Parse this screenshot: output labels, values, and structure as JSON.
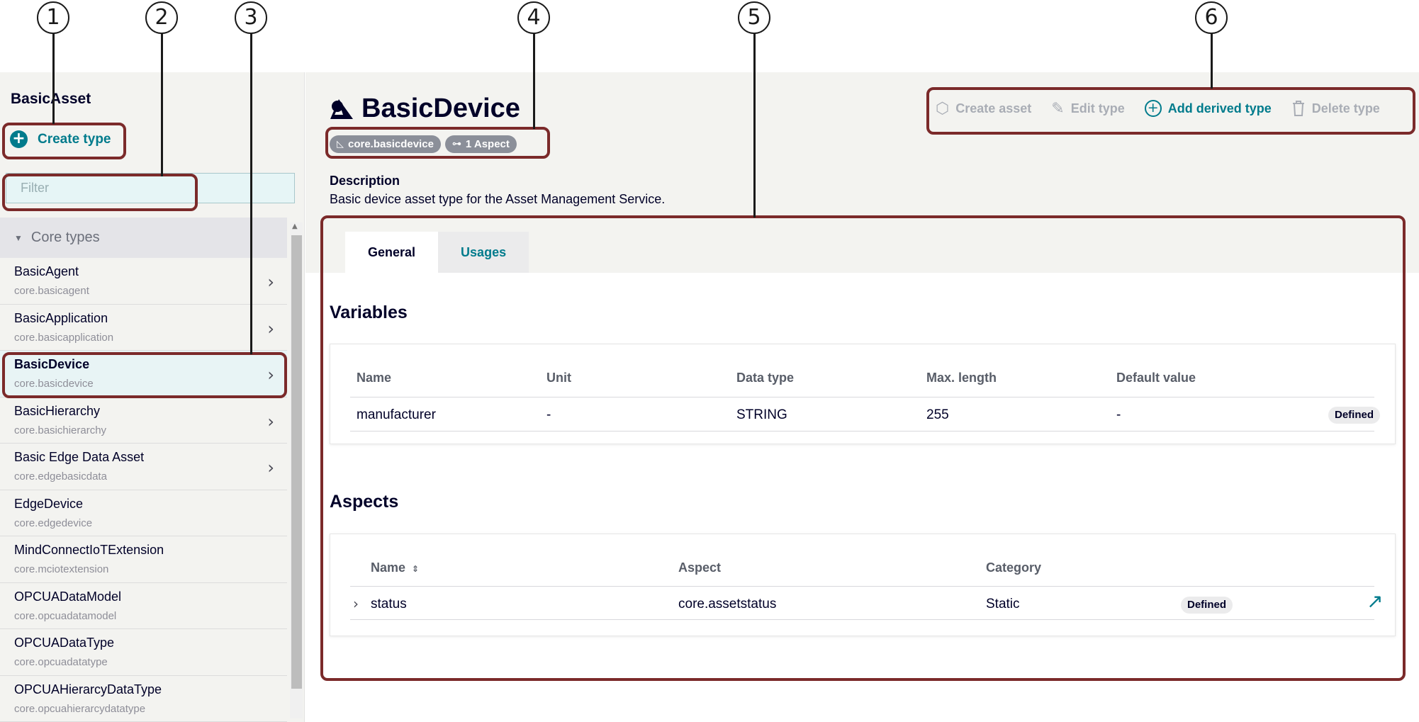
{
  "callouts": [
    "1",
    "2",
    "3",
    "4",
    "5",
    "6"
  ],
  "sidebar": {
    "title": "BasicAsset",
    "create_type_label": "Create type",
    "filter_placeholder": "Filter",
    "group_label": "Core types",
    "items": [
      {
        "name": "BasicAgent",
        "id": "core.basicagent",
        "has_chevron": true
      },
      {
        "name": "BasicApplication",
        "id": "core.basicapplication",
        "has_chevron": true
      },
      {
        "name": "BasicDevice",
        "id": "core.basicdevice",
        "has_chevron": true,
        "selected": true
      },
      {
        "name": "BasicHierarchy",
        "id": "core.basichierarchy",
        "has_chevron": true
      },
      {
        "name": "Basic Edge Data Asset",
        "id": "core.edgebasicdata",
        "has_chevron": true
      },
      {
        "name": "EdgeDevice",
        "id": "core.edgedevice",
        "has_chevron": false
      },
      {
        "name": "MindConnectIoTExtension",
        "id": "core.mciotextension",
        "has_chevron": false
      },
      {
        "name": "OPCUADataModel",
        "id": "core.opcuadatamodel",
        "has_chevron": false
      },
      {
        "name": "OPCUADataType",
        "id": "core.opcuadatatype",
        "has_chevron": false
      },
      {
        "name": "OPCUAHierarcyDataType",
        "id": "core.opcuahierarcydatatype",
        "has_chevron": false
      }
    ]
  },
  "header": {
    "title": "BasicDevice",
    "chip_id": "core.basicdevice",
    "chip_aspects": "1 Aspect",
    "description_label": "Description",
    "description": "Basic device asset type for the Asset Management Service."
  },
  "actions": {
    "create_asset": "Create asset",
    "edit_type": "Edit type",
    "add_derived_type": "Add derived type",
    "delete_type": "Delete type"
  },
  "tabs": [
    "General",
    "Usages"
  ],
  "variables": {
    "title": "Variables",
    "columns": [
      "Name",
      "Unit",
      "Data type",
      "Max. length",
      "Default value"
    ],
    "rows": [
      {
        "name": "manufacturer",
        "unit": "-",
        "data_type": "STRING",
        "max_length": "255",
        "default_value": "-",
        "status": "Defined"
      }
    ]
  },
  "aspects": {
    "title": "Aspects",
    "columns": [
      "Name",
      "Aspect",
      "Category"
    ],
    "rows": [
      {
        "name": "status",
        "aspect": "core.assetstatus",
        "category": "Static",
        "status": "Defined"
      }
    ]
  },
  "colors": {
    "accent": "#007b8c",
    "highlight": "#7b2a2a",
    "text": "#000028"
  },
  "icons": [
    "plus-circle-icon",
    "chevron-right-icon",
    "chevron-down-icon",
    "asset-type-logo-icon",
    "asset-type-icon",
    "aspect-icon",
    "create-asset-icon",
    "pencil-icon",
    "add-circle-icon",
    "trash-icon",
    "sort-icon",
    "external-link-icon"
  ]
}
